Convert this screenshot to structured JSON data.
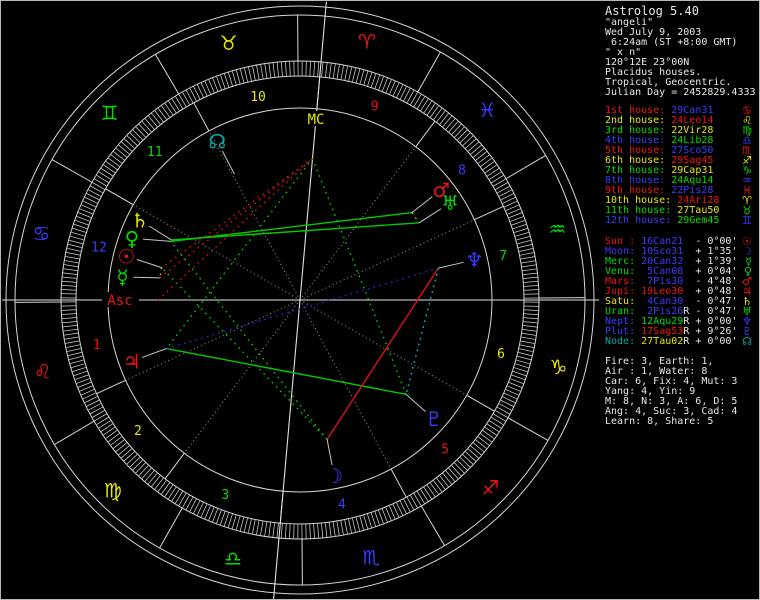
{
  "colors": {
    "red": "#ef1212",
    "yellow": "#e8e800",
    "green": "#00dd00",
    "blue": "#3b3bff",
    "teal": "#00aaaa",
    "white": "#e8e8e8",
    "gray": "#9a9a9a",
    "wheel_line": "#d6d6d6",
    "axis": "#e2e2e2",
    "tick": "#cfcfcf",
    "pointer": "#c6c6c6",
    "asp_green": "#00cc00",
    "asp_red": "#e01010",
    "asp_cyan": "#00cccc",
    "asp_yellow": "#cccc00",
    "asp_blue": "#2a2ad8",
    "black": "#000000"
  },
  "panel": {
    "header": [
      {
        "text": "Astrolog 5.40",
        "big": true
      },
      {
        "text": "\"angeli\""
      },
      {
        "text": "Wed July 9, 2003"
      },
      {
        "text": " 6:24am (ST +8:00 GMT)"
      },
      {
        "text": "\" x n\""
      },
      {
        "text": "120°12E 23°00N"
      },
      {
        "text": "Placidus houses."
      },
      {
        "text": "Tropical, Geocentric."
      },
      {
        "text": "Julian Day = 2452829.4333"
      }
    ],
    "houses": [
      {
        "label": "1st house:",
        "value": "29Can31",
        "label_color": "red",
        "value_color": "blue",
        "glyph": "♋",
        "glyph_color": "red"
      },
      {
        "label": "2nd house:",
        "value": "24Leo14",
        "label_color": "yellow",
        "value_color": "red",
        "glyph": "♌",
        "glyph_color": "yellow"
      },
      {
        "label": "3rd house:",
        "value": "22Vir28",
        "label_color": "green",
        "value_color": "yellow",
        "glyph": "♍",
        "glyph_color": "green"
      },
      {
        "label": "4th house:",
        "value": "24Lib28",
        "label_color": "blue",
        "value_color": "green",
        "glyph": "♎",
        "glyph_color": "blue"
      },
      {
        "label": "5th house:",
        "value": "27Sco50",
        "label_color": "red",
        "value_color": "blue",
        "glyph": "♏",
        "glyph_color": "red"
      },
      {
        "label": "6th house:",
        "value": "29Sag45",
        "label_color": "yellow",
        "value_color": "red",
        "glyph": "♐",
        "glyph_color": "yellow"
      },
      {
        "label": "7th house:",
        "value": "29Cap31",
        "label_color": "green",
        "value_color": "yellow",
        "glyph": "♑",
        "glyph_color": "green"
      },
      {
        "label": "8th house:",
        "value": "24Aqu14",
        "label_color": "blue",
        "value_color": "green",
        "glyph": "♒",
        "glyph_color": "blue"
      },
      {
        "label": "9th house:",
        "value": "22Pis28",
        "label_color": "red",
        "value_color": "blue",
        "glyph": "♓",
        "glyph_color": "red"
      },
      {
        "label": "10th house:",
        "value": "24Ari28",
        "label_color": "yellow",
        "value_color": "red",
        "glyph": "♈",
        "glyph_color": "yellow"
      },
      {
        "label": "11th house:",
        "value": "27Tau50",
        "label_color": "green",
        "value_color": "yellow",
        "glyph": "♉",
        "glyph_color": "green"
      },
      {
        "label": "12th house:",
        "value": "29Gem45",
        "label_color": "blue",
        "value_color": "green",
        "glyph": "♊",
        "glyph_color": "blue"
      }
    ],
    "planets": [
      {
        "name": "Sun ",
        "value": " 16Can21",
        "retro": " ",
        "lat": "- 0°00'",
        "color": "red",
        "value_color": "blue",
        "glyph": "☉"
      },
      {
        "name": "Moon",
        "value": " 10Sco31",
        "retro": " ",
        "lat": "+ 1°35'",
        "color": "blue",
        "value_color": "blue",
        "glyph": "☽"
      },
      {
        "name": "Merc",
        "value": " 20Can32",
        "retro": " ",
        "lat": "+ 1°39'",
        "color": "green",
        "value_color": "blue",
        "glyph": "☿"
      },
      {
        "name": "Venu",
        "value": "  5Can08",
        "retro": " ",
        "lat": "+ 0°04'",
        "color": "green",
        "value_color": "blue",
        "glyph": "♀"
      },
      {
        "name": "Mars",
        "value": "  7Pis30",
        "retro": " ",
        "lat": "- 4°48'",
        "color": "red",
        "value_color": "blue",
        "glyph": "♂"
      },
      {
        "name": "Jupi",
        "value": " 19Leo30",
        "retro": " ",
        "lat": "+ 0°48'",
        "color": "red",
        "value_color": "red",
        "glyph": "♃"
      },
      {
        "name": "Satu",
        "value": "  4Can30",
        "retro": " ",
        "lat": "- 0°47'",
        "color": "yellow",
        "value_color": "blue",
        "glyph": "♄"
      },
      {
        "name": "Uran",
        "value": "  2Pis26",
        "retro": "R",
        "lat": "- 0°47'",
        "color": "green",
        "value_color": "blue",
        "glyph": "♅"
      },
      {
        "name": "Nept",
        "value": " 12Aqu29",
        "retro": "R",
        "lat": "+ 0°00'",
        "color": "blue",
        "value_color": "green",
        "glyph": "♆"
      },
      {
        "name": "Plut",
        "value": " 17Sag53",
        "retro": "R",
        "lat": "+ 9°26'",
        "color": "blue",
        "value_color": "red",
        "glyph": "♇"
      },
      {
        "name": "Node",
        "value": " 27Tau02",
        "retro": "R",
        "lat": "+ 0°00'",
        "color": "teal",
        "value_color": "yellow",
        "glyph": "☊"
      }
    ],
    "stats": [
      "Fire: 3, Earth: 1,",
      "Air : 1, Water: 8",
      "Car: 6, Fix: 4, Mut: 3",
      "Yang: 4, Yin: 9",
      "M: 8, N: 3, A: 6, D: 5",
      "Ang: 4, Suc: 3, Cad: 4",
      "Learn: 8, Share: 5"
    ]
  },
  "wheel": {
    "asc": 119.517,
    "mc_label": "MC",
    "asc_label": "Asc",
    "cusps": [
      119.517,
      144.233,
      172.467,
      204.467,
      237.833,
      269.75,
      299.517,
      324.233,
      352.467,
      24.467,
      57.833,
      89.75
    ],
    "house_number_colors": [
      "red",
      "yellow",
      "green",
      "blue",
      "red",
      "yellow",
      "green",
      "blue",
      "red",
      "yellow",
      "green",
      "blue"
    ],
    "signs": [
      {
        "name": "Aries",
        "glyph": "♈",
        "color": "red"
      },
      {
        "name": "Taurus",
        "glyph": "♉",
        "color": "yellow"
      },
      {
        "name": "Gemini",
        "glyph": "♊",
        "color": "green"
      },
      {
        "name": "Cancer",
        "glyph": "♋",
        "color": "blue"
      },
      {
        "name": "Leo",
        "glyph": "♌",
        "color": "red"
      },
      {
        "name": "Virgo",
        "glyph": "♍",
        "color": "yellow"
      },
      {
        "name": "Libra",
        "glyph": "♎",
        "color": "green"
      },
      {
        "name": "Scorpio",
        "glyph": "♏",
        "color": "blue"
      },
      {
        "name": "Sagittarius",
        "glyph": "♐",
        "color": "red"
      },
      {
        "name": "Capricorn",
        "glyph": "♑",
        "color": "yellow"
      },
      {
        "name": "Aquarius",
        "glyph": "♒",
        "color": "green"
      },
      {
        "name": "Pisces",
        "glyph": "♓",
        "color": "blue"
      }
    ],
    "planets": [
      {
        "name": "Sun",
        "glyph": "☉",
        "color": "red",
        "lon": 106.35,
        "gphi": 194.2
      },
      {
        "name": "Moon",
        "glyph": "☽",
        "color": "blue",
        "lon": 220.517
      },
      {
        "name": "Mercury",
        "glyph": "☿",
        "color": "green",
        "lon": 110.533,
        "gphi": 187.4
      },
      {
        "name": "Venus",
        "glyph": "♀",
        "color": "green",
        "lon": 95.133,
        "gphi": 200.2
      },
      {
        "name": "Mars",
        "glyph": "♂",
        "color": "red",
        "lon": 337.5
      },
      {
        "name": "Jupiter",
        "glyph": "♃",
        "color": "red",
        "lon": 139.5
      },
      {
        "name": "Saturn",
        "glyph": "♄",
        "color": "yellow",
        "lon": 94.5,
        "gphi": 206.5
      },
      {
        "name": "Uranus",
        "glyph": "♅",
        "color": "green",
        "lon": 332.433
      },
      {
        "name": "Neptune",
        "glyph": "♆",
        "color": "blue",
        "lon": 312.483
      },
      {
        "name": "Pluto",
        "glyph": "♇",
        "color": "blue",
        "lon": 257.883
      },
      {
        "name": "Node",
        "glyph": "☊",
        "color": "teal",
        "lon": 57.033
      }
    ],
    "aspects": [
      {
        "a": "Venus",
        "b": "Mars",
        "color": "asp_green",
        "solid": true
      },
      {
        "a": "Saturn",
        "b": "Uranus",
        "color": "asp_green",
        "solid": true
      },
      {
        "a": "Jupiter",
        "b": "Pluto",
        "color": "asp_green",
        "solid": true
      },
      {
        "a": "Moon",
        "b": "Neptune",
        "color": "asp_red",
        "solid": true
      },
      {
        "a": "Moon",
        "b": "Sun",
        "color": "asp_green",
        "solid": false
      },
      {
        "a": "Moon",
        "b": "Venus",
        "color": "asp_green",
        "solid": false
      },
      {
        "a": "MC",
        "b": "Jupiter",
        "color": "asp_green",
        "solid": false
      },
      {
        "a": "MC",
        "b": "Pluto",
        "color": "asp_green",
        "solid": false
      },
      {
        "a": "MC",
        "b": "Sun",
        "color": "asp_red",
        "solid": false
      },
      {
        "a": "MC",
        "b": "Mercury",
        "color": "asp_red",
        "solid": false
      },
      {
        "a": "Asc",
        "b": "MC",
        "color": "asp_red",
        "solid": false
      },
      {
        "a": "Neptune",
        "b": "Pluto",
        "color": "asp_cyan",
        "solid": false
      },
      {
        "a": "Sun",
        "b": "Mercury",
        "color": "asp_yellow",
        "solid": false
      },
      {
        "a": "Mars",
        "b": "Uranus",
        "color": "asp_yellow",
        "solid": false
      },
      {
        "a": "Jupiter",
        "b": "Neptune",
        "color": "asp_blue",
        "solid": false
      }
    ]
  }
}
